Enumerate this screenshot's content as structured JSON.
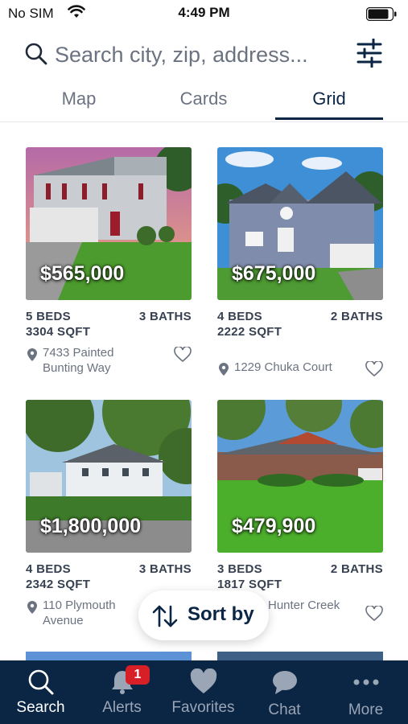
{
  "status": {
    "carrier": "No SIM",
    "time": "4:49 PM"
  },
  "search": {
    "placeholder": "Search city, zip, address..."
  },
  "view_tabs": [
    {
      "label": "Map",
      "active": false
    },
    {
      "label": "Cards",
      "active": false
    },
    {
      "label": "Grid",
      "active": true
    }
  ],
  "listings": [
    {
      "price": "$565,000",
      "beds": "5 BEDS",
      "baths": "3 BATHS",
      "sqft": "3304 SQFT",
      "address": "7433 Painted Bunting Way"
    },
    {
      "price": "$675,000",
      "beds": "4 BEDS",
      "baths": "2 BATHS",
      "sqft": "2222 SQFT",
      "address": "1229 Chuka Court"
    },
    {
      "price": "$1,800,000",
      "beds": "4 BEDS",
      "baths": "3 BATHS",
      "sqft": "2342 SQFT",
      "address": "110 Plymouth Avenue"
    },
    {
      "price": "$479,900",
      "beds": "3 BEDS",
      "baths": "2 BATHS",
      "sqft": "1817 SQFT",
      "address": "Hunter Creek"
    }
  ],
  "sort": {
    "label": "Sort by"
  },
  "nav": [
    {
      "label": "Search",
      "icon": "search-icon",
      "active": true
    },
    {
      "label": "Alerts",
      "icon": "bell-icon",
      "active": false,
      "badge": "1"
    },
    {
      "label": "Favorites",
      "icon": "heart-icon",
      "active": false
    },
    {
      "label": "Chat",
      "icon": "chat-icon",
      "active": false
    },
    {
      "label": "More",
      "icon": "more-icon",
      "active": false
    }
  ],
  "colors": {
    "navy": "#0b2545",
    "badge_red": "#d61f26",
    "muted": "#6b7280"
  }
}
